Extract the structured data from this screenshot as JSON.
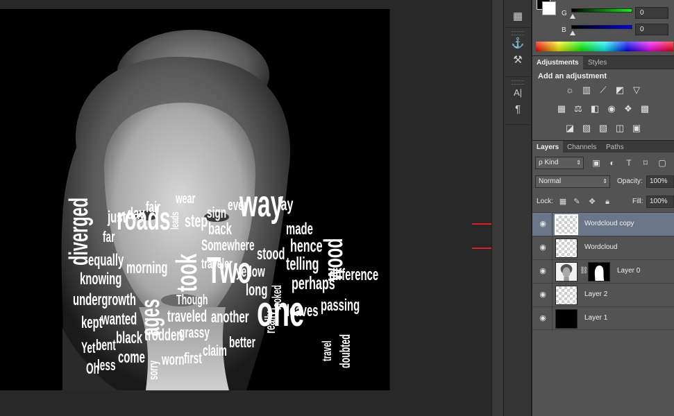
{
  "canvas": {
    "words": [
      {
        "text": "diverged",
        "vertical": true
      },
      {
        "text": "just"
      },
      {
        "text": "day"
      },
      {
        "text": "fair"
      },
      {
        "text": "wear"
      },
      {
        "text": "far"
      },
      {
        "text": "roads"
      },
      {
        "text": "leads",
        "vertical": true
      },
      {
        "text": "step"
      },
      {
        "text": "sign"
      },
      {
        "text": "ever"
      },
      {
        "text": "back"
      },
      {
        "text": "way"
      },
      {
        "text": "lay"
      },
      {
        "text": "made"
      },
      {
        "text": "wood",
        "vertical": true
      },
      {
        "text": "took",
        "vertical": true
      },
      {
        "text": "Somewhere"
      },
      {
        "text": "hence"
      },
      {
        "text": "equally"
      },
      {
        "text": "traveler"
      },
      {
        "text": "stood"
      },
      {
        "text": "telling"
      },
      {
        "text": "knowing"
      },
      {
        "text": "morning"
      },
      {
        "text": "yellow"
      },
      {
        "text": "looked",
        "vertical": true
      },
      {
        "text": "perhaps"
      },
      {
        "text": "difference"
      },
      {
        "text": "ages",
        "vertical": true
      },
      {
        "text": "Two"
      },
      {
        "text": "long"
      },
      {
        "text": "undergrowth"
      },
      {
        "text": "Though"
      },
      {
        "text": "really",
        "vertical": true
      },
      {
        "text": "passing"
      },
      {
        "text": "kept"
      },
      {
        "text": "wanted"
      },
      {
        "text": "traveled"
      },
      {
        "text": "another"
      },
      {
        "text": "leaves"
      },
      {
        "text": "grassy"
      },
      {
        "text": "black"
      },
      {
        "text": "trodden"
      },
      {
        "text": "one"
      },
      {
        "text": "travel",
        "vertical": true
      },
      {
        "text": "doubted",
        "vertical": true
      },
      {
        "text": "Yet"
      },
      {
        "text": "bent"
      },
      {
        "text": "claim"
      },
      {
        "text": "better"
      },
      {
        "text": "sorry",
        "vertical": true
      },
      {
        "text": "come"
      },
      {
        "text": "worn"
      },
      {
        "text": "first"
      },
      {
        "text": "Oh"
      },
      {
        "text": "less"
      }
    ]
  },
  "tools": [
    {
      "icon": "brush-settings-icon",
      "glyph": "⚙"
    },
    {
      "icon": "clone-source-icon",
      "glyph": "✦"
    },
    {
      "icon": "tool-presets-icon",
      "glyph": "⚒"
    },
    {
      "icon": "character-icon",
      "glyph": "A|"
    },
    {
      "icon": "paragraph-icon",
      "glyph": "¶"
    }
  ],
  "color": {
    "g_label": "G",
    "g_value": "0",
    "b_label": "B",
    "b_value": "0"
  },
  "adjustments": {
    "tabs": [
      "Adjustments",
      "Styles"
    ],
    "title": "Add an adjustment",
    "icons": [
      [
        "brightness-icon",
        "levels-icon",
        "curves-icon",
        "exposure-icon",
        "vibrance-icon"
      ],
      [
        "hue-saturation-icon",
        "color-balance-icon",
        "black-white-icon",
        "photo-filter-icon",
        "channel-mixer-icon",
        "color-lookup-icon"
      ],
      [
        "invert-icon",
        "posterize-icon",
        "threshold-icon",
        "gradient-map-icon",
        "selective-color-icon"
      ]
    ]
  },
  "layers_panel": {
    "tabs": [
      "Layers",
      "Channels",
      "Paths"
    ],
    "kind_label": "ρ Kind",
    "blend_mode": "Normal",
    "opacity_label": "Opacity:",
    "opacity_value": "100%",
    "lock_label": "Lock:",
    "fill_label": "Fill:",
    "fill_value": "100%",
    "layers": [
      {
        "name": "Wordcloud copy",
        "thumb": "transparent",
        "selected": true,
        "visible": true
      },
      {
        "name": "Wordcloud",
        "thumb": "transparent",
        "selected": false,
        "visible": true
      },
      {
        "name": "Layer 0",
        "thumb": "photo-with-mask",
        "selected": false,
        "visible": true
      },
      {
        "name": "Layer 2",
        "thumb": "transparent",
        "selected": false,
        "visible": true
      },
      {
        "name": "Layer 1",
        "thumb": "black",
        "selected": false,
        "visible": true
      }
    ]
  },
  "colors": {
    "arrow": "#e02020",
    "selected_row": "#6b7788",
    "panel": "#535353"
  }
}
